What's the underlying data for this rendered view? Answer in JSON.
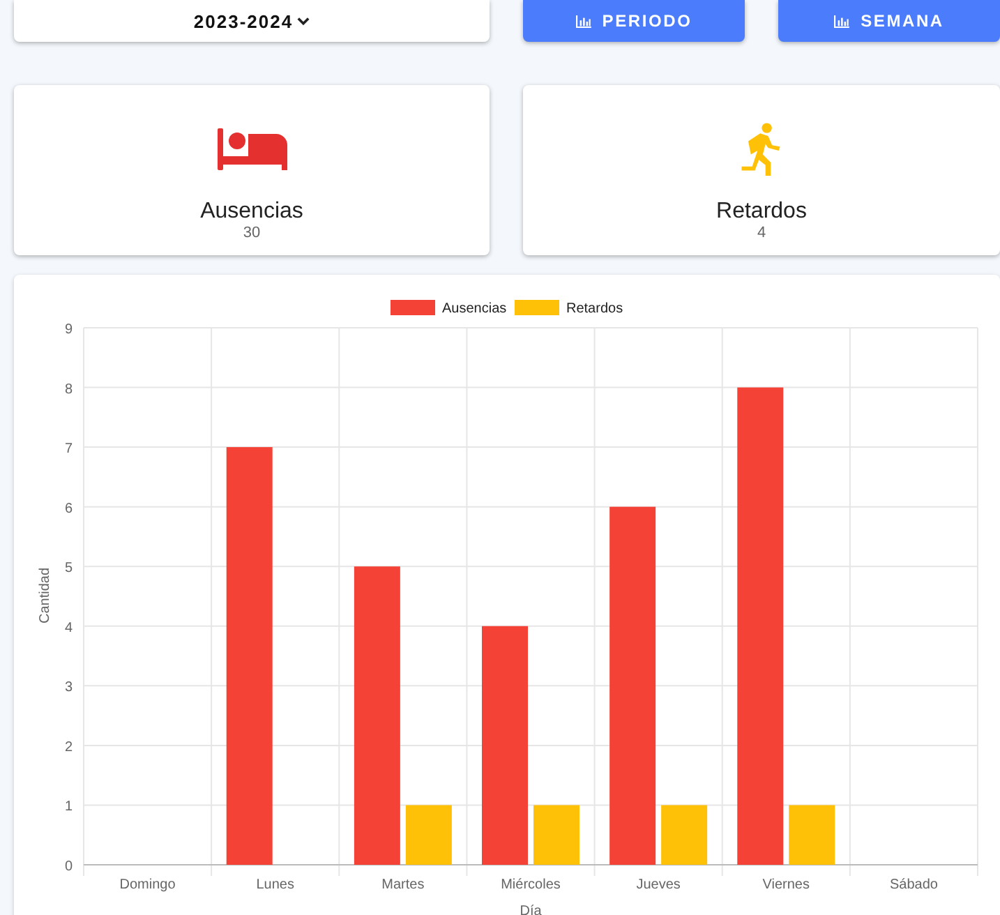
{
  "year_select": {
    "value": "2023-2024"
  },
  "buttons": [
    {
      "label": "PERIODO"
    },
    {
      "label": "SEMANA"
    }
  ],
  "stats": [
    {
      "kind": "absences",
      "label": "Ausencias",
      "value": "30"
    },
    {
      "kind": "late",
      "label": "Retardos",
      "value": "4"
    }
  ],
  "chart": {
    "chart_data": {
      "type": "bar",
      "xlabel": "Día",
      "ylabel": "Cantidad",
      "categories": [
        "Domingo",
        "Lunes",
        "Martes",
        "Miércoles",
        "Jueves",
        "Viernes",
        "Sábado"
      ],
      "series": [
        {
          "name": "Ausencias",
          "color": "#f44336",
          "values": [
            0,
            7,
            5,
            4,
            6,
            8,
            0
          ]
        },
        {
          "name": "Retardos",
          "color": "#ffc107",
          "values": [
            0,
            0,
            1,
            1,
            1,
            1,
            0
          ]
        }
      ],
      "ylim": [
        0,
        9
      ],
      "grid": true,
      "legend": true,
      "yticks": [
        0,
        1,
        2,
        3,
        4,
        5,
        6,
        7,
        8,
        9
      ]
    }
  }
}
